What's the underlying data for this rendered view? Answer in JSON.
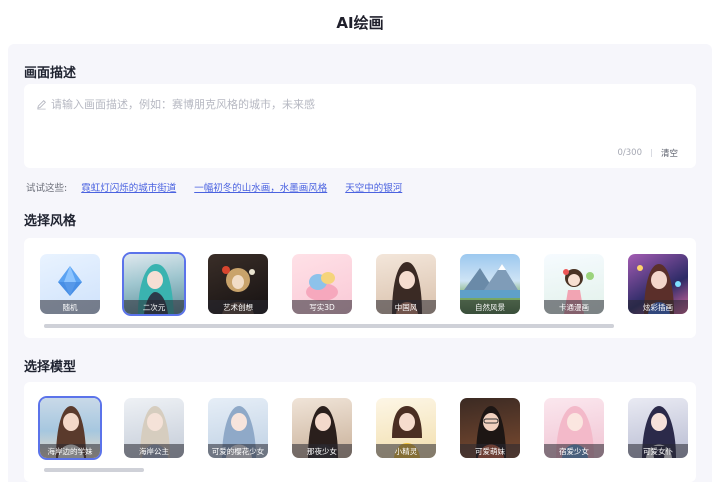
{
  "header": {
    "title": "AI绘画"
  },
  "description": {
    "section_title": "画面描述",
    "placeholder": "请输入画面描述，例如：赛博朋克风格的城市，未来感",
    "counter": "0/300",
    "clear_label": "清空"
  },
  "suggestions": {
    "label": "试试这些:",
    "items": [
      "霓虹灯闪烁的城市街道",
      "一幅初冬的山水画，水墨画风格",
      "天空中的银河"
    ]
  },
  "styles": {
    "section_title": "选择风格",
    "items": [
      {
        "label": "随机",
        "icon": "diamond-icon"
      },
      {
        "label": "二次元",
        "selected": true
      },
      {
        "label": "艺术创想"
      },
      {
        "label": "写实3D"
      },
      {
        "label": "中国风"
      },
      {
        "label": "自然风景"
      },
      {
        "label": "卡通漫画"
      },
      {
        "label": "炫彩插画"
      }
    ]
  },
  "models": {
    "section_title": "选择模型",
    "items": [
      {
        "label": "海岸边的学妹",
        "selected": true
      },
      {
        "label": "海岸公主"
      },
      {
        "label": "可爱的樱花少女"
      },
      {
        "label": "那夜少女"
      },
      {
        "label": "小精灵"
      },
      {
        "label": "可爱萌妹"
      },
      {
        "label": "宿爱少女"
      },
      {
        "label": "可爱女仆"
      }
    ]
  },
  "colors": {
    "accent": "#5b73ea",
    "link": "#4b63e0",
    "page_bg": "#f6f6fb"
  }
}
